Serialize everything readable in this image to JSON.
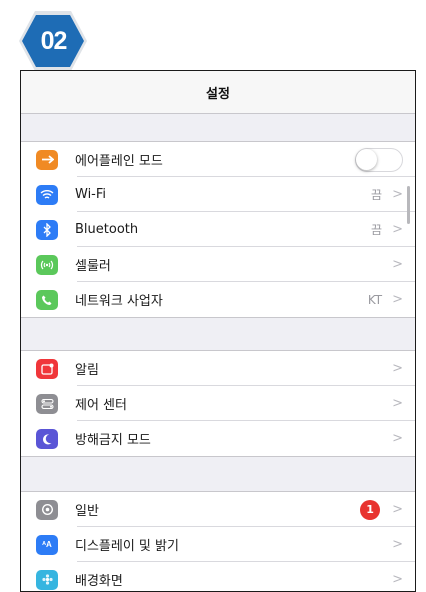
{
  "step": {
    "number": "02",
    "color": "#1e6cb5"
  },
  "settings": {
    "title": "설정",
    "groups": [
      {
        "items": [
          {
            "label": "에어플레인 모드",
            "icon": "airplane-icon",
            "icon_color": "#f08a24",
            "toggle": false
          },
          {
            "label": "Wi-Fi",
            "icon": "wifi-icon",
            "icon_color": "#2d7cf6",
            "detail": "끔"
          },
          {
            "label": "Bluetooth",
            "icon": "bluetooth-icon",
            "icon_color": "#2d7cf6",
            "detail": "끔"
          },
          {
            "label": "셀룰러",
            "icon": "cellular-icon",
            "icon_color": "#5bc85b"
          },
          {
            "label": "네트워크 사업자",
            "icon": "phone-icon",
            "icon_color": "#5bc85b",
            "detail": "KT"
          }
        ]
      },
      {
        "items": [
          {
            "label": "알림",
            "icon": "notification-icon",
            "icon_color": "#f0363a"
          },
          {
            "label": "제어 센터",
            "icon": "control-center-icon",
            "icon_color": "#8e8e93"
          },
          {
            "label": "방해금지 모드",
            "icon": "moon-icon",
            "icon_color": "#5a55d6"
          }
        ]
      },
      {
        "items": [
          {
            "label": "일반",
            "icon": "gear-icon",
            "icon_color": "#8e8e93",
            "badge": "1"
          },
          {
            "label": "디스플레이 및 밝기",
            "icon": "display-icon",
            "icon_color": "#2d7cf6"
          },
          {
            "label": "배경화면",
            "icon": "wallpaper-icon",
            "icon_color": "#36b5e0"
          }
        ]
      }
    ]
  }
}
